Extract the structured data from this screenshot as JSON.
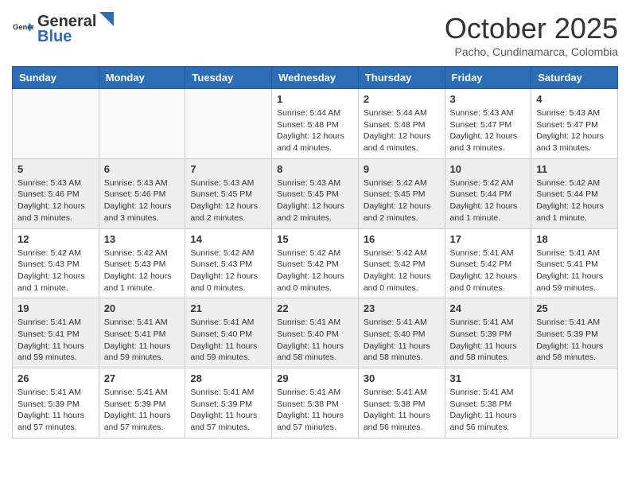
{
  "header": {
    "logo_general": "General",
    "logo_blue": "Blue",
    "month_title": "October 2025",
    "subtitle": "Pacho, Cundinamarca, Colombia"
  },
  "days_of_week": [
    "Sunday",
    "Monday",
    "Tuesday",
    "Wednesday",
    "Thursday",
    "Friday",
    "Saturday"
  ],
  "weeks": [
    [
      {
        "day": "",
        "sunrise": "",
        "sunset": "",
        "daylight": ""
      },
      {
        "day": "",
        "sunrise": "",
        "sunset": "",
        "daylight": ""
      },
      {
        "day": "",
        "sunrise": "",
        "sunset": "",
        "daylight": ""
      },
      {
        "day": "1",
        "sunrise": "Sunrise: 5:44 AM",
        "sunset": "Sunset: 5:48 PM",
        "daylight": "Daylight: 12 hours and 4 minutes."
      },
      {
        "day": "2",
        "sunrise": "Sunrise: 5:44 AM",
        "sunset": "Sunset: 5:48 PM",
        "daylight": "Daylight: 12 hours and 4 minutes."
      },
      {
        "day": "3",
        "sunrise": "Sunrise: 5:43 AM",
        "sunset": "Sunset: 5:47 PM",
        "daylight": "Daylight: 12 hours and 3 minutes."
      },
      {
        "day": "4",
        "sunrise": "Sunrise: 5:43 AM",
        "sunset": "Sunset: 5:47 PM",
        "daylight": "Daylight: 12 hours and 3 minutes."
      }
    ],
    [
      {
        "day": "5",
        "sunrise": "Sunrise: 5:43 AM",
        "sunset": "Sunset: 5:46 PM",
        "daylight": "Daylight: 12 hours and 3 minutes."
      },
      {
        "day": "6",
        "sunrise": "Sunrise: 5:43 AM",
        "sunset": "Sunset: 5:46 PM",
        "daylight": "Daylight: 12 hours and 3 minutes."
      },
      {
        "day": "7",
        "sunrise": "Sunrise: 5:43 AM",
        "sunset": "Sunset: 5:45 PM",
        "daylight": "Daylight: 12 hours and 2 minutes."
      },
      {
        "day": "8",
        "sunrise": "Sunrise: 5:43 AM",
        "sunset": "Sunset: 5:45 PM",
        "daylight": "Daylight: 12 hours and 2 minutes."
      },
      {
        "day": "9",
        "sunrise": "Sunrise: 5:42 AM",
        "sunset": "Sunset: 5:45 PM",
        "daylight": "Daylight: 12 hours and 2 minutes."
      },
      {
        "day": "10",
        "sunrise": "Sunrise: 5:42 AM",
        "sunset": "Sunset: 5:44 PM",
        "daylight": "Daylight: 12 hours and 1 minute."
      },
      {
        "day": "11",
        "sunrise": "Sunrise: 5:42 AM",
        "sunset": "Sunset: 5:44 PM",
        "daylight": "Daylight: 12 hours and 1 minute."
      }
    ],
    [
      {
        "day": "12",
        "sunrise": "Sunrise: 5:42 AM",
        "sunset": "Sunset: 5:43 PM",
        "daylight": "Daylight: 12 hours and 1 minute."
      },
      {
        "day": "13",
        "sunrise": "Sunrise: 5:42 AM",
        "sunset": "Sunset: 5:43 PM",
        "daylight": "Daylight: 12 hours and 1 minute."
      },
      {
        "day": "14",
        "sunrise": "Sunrise: 5:42 AM",
        "sunset": "Sunset: 5:43 PM",
        "daylight": "Daylight: 12 hours and 0 minutes."
      },
      {
        "day": "15",
        "sunrise": "Sunrise: 5:42 AM",
        "sunset": "Sunset: 5:42 PM",
        "daylight": "Daylight: 12 hours and 0 minutes."
      },
      {
        "day": "16",
        "sunrise": "Sunrise: 5:42 AM",
        "sunset": "Sunset: 5:42 PM",
        "daylight": "Daylight: 12 hours and 0 minutes."
      },
      {
        "day": "17",
        "sunrise": "Sunrise: 5:41 AM",
        "sunset": "Sunset: 5:42 PM",
        "daylight": "Daylight: 12 hours and 0 minutes."
      },
      {
        "day": "18",
        "sunrise": "Sunrise: 5:41 AM",
        "sunset": "Sunset: 5:41 PM",
        "daylight": "Daylight: 11 hours and 59 minutes."
      }
    ],
    [
      {
        "day": "19",
        "sunrise": "Sunrise: 5:41 AM",
        "sunset": "Sunset: 5:41 PM",
        "daylight": "Daylight: 11 hours and 59 minutes."
      },
      {
        "day": "20",
        "sunrise": "Sunrise: 5:41 AM",
        "sunset": "Sunset: 5:41 PM",
        "daylight": "Daylight: 11 hours and 59 minutes."
      },
      {
        "day": "21",
        "sunrise": "Sunrise: 5:41 AM",
        "sunset": "Sunset: 5:40 PM",
        "daylight": "Daylight: 11 hours and 59 minutes."
      },
      {
        "day": "22",
        "sunrise": "Sunrise: 5:41 AM",
        "sunset": "Sunset: 5:40 PM",
        "daylight": "Daylight: 11 hours and 58 minutes."
      },
      {
        "day": "23",
        "sunrise": "Sunrise: 5:41 AM",
        "sunset": "Sunset: 5:40 PM",
        "daylight": "Daylight: 11 hours and 58 minutes."
      },
      {
        "day": "24",
        "sunrise": "Sunrise: 5:41 AM",
        "sunset": "Sunset: 5:39 PM",
        "daylight": "Daylight: 11 hours and 58 minutes."
      },
      {
        "day": "25",
        "sunrise": "Sunrise: 5:41 AM",
        "sunset": "Sunset: 5:39 PM",
        "daylight": "Daylight: 11 hours and 58 minutes."
      }
    ],
    [
      {
        "day": "26",
        "sunrise": "Sunrise: 5:41 AM",
        "sunset": "Sunset: 5:39 PM",
        "daylight": "Daylight: 11 hours and 57 minutes."
      },
      {
        "day": "27",
        "sunrise": "Sunrise: 5:41 AM",
        "sunset": "Sunset: 5:39 PM",
        "daylight": "Daylight: 11 hours and 57 minutes."
      },
      {
        "day": "28",
        "sunrise": "Sunrise: 5:41 AM",
        "sunset": "Sunset: 5:39 PM",
        "daylight": "Daylight: 11 hours and 57 minutes."
      },
      {
        "day": "29",
        "sunrise": "Sunrise: 5:41 AM",
        "sunset": "Sunset: 5:38 PM",
        "daylight": "Daylight: 11 hours and 57 minutes."
      },
      {
        "day": "30",
        "sunrise": "Sunrise: 5:41 AM",
        "sunset": "Sunset: 5:38 PM",
        "daylight": "Daylight: 11 hours and 56 minutes."
      },
      {
        "day": "31",
        "sunrise": "Sunrise: 5:41 AM",
        "sunset": "Sunset: 5:38 PM",
        "daylight": "Daylight: 11 hours and 56 minutes."
      },
      {
        "day": "",
        "sunrise": "",
        "sunset": "",
        "daylight": ""
      }
    ]
  ]
}
